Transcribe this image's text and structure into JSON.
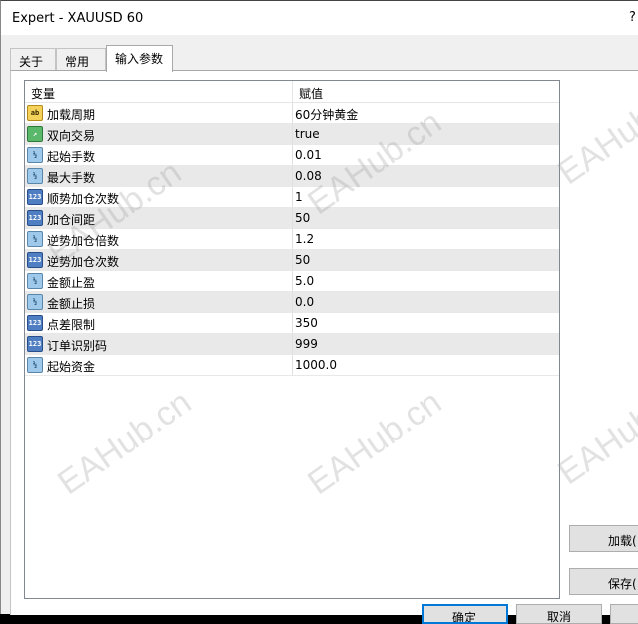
{
  "window": {
    "title": "Expert - XAUUSD 60",
    "help": "?"
  },
  "tabs": [
    {
      "label": "关于",
      "active": false
    },
    {
      "label": "常用",
      "active": false
    },
    {
      "label": "输入参数",
      "active": true
    }
  ],
  "grid": {
    "columns": [
      "变量",
      "赋值"
    ],
    "rows": [
      {
        "name": "加载周期",
        "value": "60分钟黄金",
        "type": "ab"
      },
      {
        "name": "双向交易",
        "value": "true",
        "type": "bool"
      },
      {
        "name": "起始手数",
        "value": "0.01",
        "type": "dbl"
      },
      {
        "name": "最大手数",
        "value": "0.08",
        "type": "dbl"
      },
      {
        "name": "顺势加仓次数",
        "value": "1",
        "type": "int"
      },
      {
        "name": "加仓间距",
        "value": "50",
        "type": "int"
      },
      {
        "name": "逆势加仓倍数",
        "value": "1.2",
        "type": "dbl"
      },
      {
        "name": "逆势加仓次数",
        "value": "50",
        "type": "int"
      },
      {
        "name": "金额止盈",
        "value": "5.0",
        "type": "dbl"
      },
      {
        "name": "金额止损",
        "value": "0.0",
        "type": "dbl"
      },
      {
        "name": "点差限制",
        "value": "350",
        "type": "int"
      },
      {
        "name": "订单识别码",
        "value": "999",
        "type": "int"
      },
      {
        "name": "起始资金",
        "value": "1000.0",
        "type": "dbl"
      }
    ]
  },
  "icon_glyphs": {
    "ab": "ab",
    "bool": "↗",
    "dbl": "½",
    "int": "123"
  },
  "buttons": {
    "load": "加载(",
    "save": "保存(",
    "ok": "确定",
    "cancel": "取消",
    "reset": ""
  },
  "watermark": "EAHub.cn"
}
